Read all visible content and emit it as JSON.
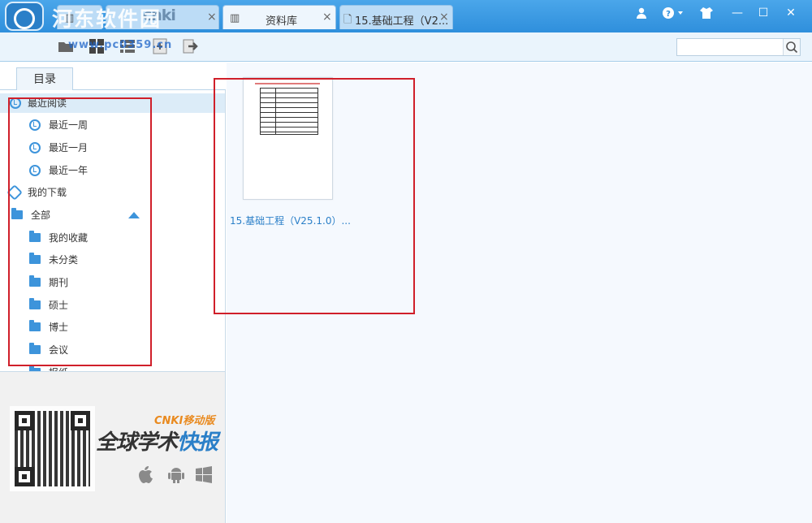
{
  "titlebar": {
    "watermark": "河东软件园",
    "brand": "cnki",
    "tabs": [
      {
        "label": "资料库",
        "close": "×"
      },
      {
        "label": "15.基础工程（V2...",
        "close": "×"
      }
    ],
    "first_tab_close": "×",
    "window_buttons": {
      "minimize": "—",
      "maximize": "☐",
      "close": "✕"
    }
  },
  "toolbar": {
    "watermark": "www.pc0359.cn",
    "search": {
      "placeholder": "",
      "value": ""
    }
  },
  "sidebar": {
    "tab_label": "目录",
    "items": [
      {
        "label": "最近阅读",
        "icon": "clock-icon"
      },
      {
        "label": "最近一周",
        "icon": "clock-icon"
      },
      {
        "label": "最近一月",
        "icon": "clock-icon"
      },
      {
        "label": "最近一年",
        "icon": "clock-icon"
      },
      {
        "label": "我的下载",
        "icon": "download-icon"
      },
      {
        "label": "全部",
        "icon": "folder-icon"
      },
      {
        "label": "我的收藏",
        "icon": "folder-icon"
      },
      {
        "label": "未分类",
        "icon": "folder-icon"
      },
      {
        "label": "期刊",
        "icon": "folder-icon"
      },
      {
        "label": "硕士",
        "icon": "folder-icon"
      },
      {
        "label": "博士",
        "icon": "folder-icon"
      },
      {
        "label": "会议",
        "icon": "folder-icon"
      },
      {
        "label": "报纸",
        "icon": "folder-icon"
      }
    ],
    "promo": {
      "brand": "CNKI移动版",
      "title_left": "全球学术",
      "title_right": "快报"
    }
  },
  "content": {
    "documents": [
      {
        "title": "15.基础工程（V25.1.0）..."
      }
    ]
  },
  "colors": {
    "accent": "#2f8fdc",
    "annotation": "#d01f2a"
  }
}
